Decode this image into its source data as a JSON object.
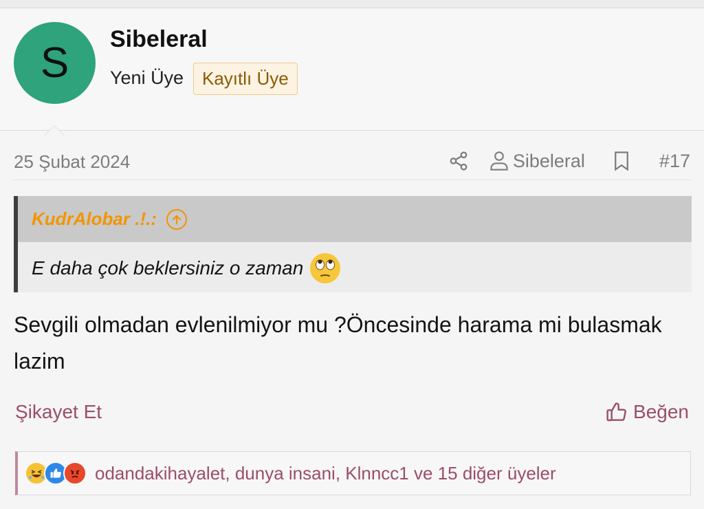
{
  "user": {
    "avatar_letter": "S",
    "avatar_color": "#2ea37c",
    "name": "Sibeleral",
    "title": "Yeni Üye",
    "badge": "Kayıtlı Üye"
  },
  "post": {
    "date": "25 Şubat 2024",
    "author": "Sibeleral",
    "number": "#17",
    "icons": [
      "share-icon",
      "user-icon",
      "bookmark-icon"
    ]
  },
  "quote": {
    "author": "KudrAlobar .!.:",
    "text": "E daha çok beklersiniz o zaman",
    "emoji": "face-with-rolling-eyes",
    "accent_color": "#f29500"
  },
  "body": {
    "text": "Sevgili olmadan evlenilmiyor mu ?Öncesinde harama mi bulasmak lazim"
  },
  "actions": {
    "report": "Şikayet Et",
    "like": "Beğen",
    "link_color": "#9b4d6a"
  },
  "reactions": {
    "icons": [
      "laugh-reaction-icon",
      "like-reaction-icon",
      "angry-reaction-icon"
    ],
    "summary": "odandakihayalet, dunya insani, Klnncc1 ve 15 diğer üyeler"
  }
}
